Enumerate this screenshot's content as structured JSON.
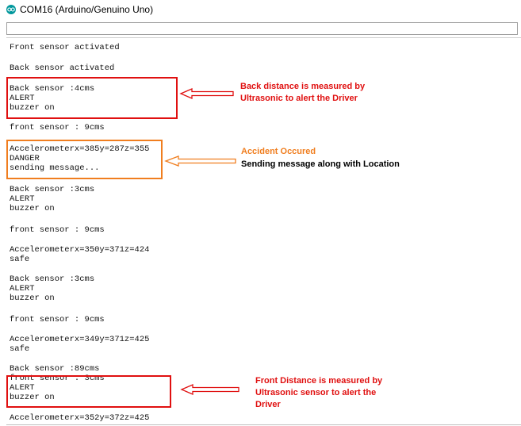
{
  "window": {
    "title": "COM16 (Arduino/Genuino Uno)",
    "app_icon": "arduino-logo-icon",
    "accent": "#00979c"
  },
  "send_input": {
    "value": "",
    "placeholder": ""
  },
  "serial_output": [
    "Front sensor activated",
    "Back sensor activated",
    "Back sensor :4cms",
    "ALERT",
    "buzzer on",
    "front sensor : 9cms",
    "Accelerometerx=385y=287z=355",
    "DANGER",
    "sending message...",
    "Back sensor :3cms",
    "ALERT",
    "buzzer on",
    "front sensor : 9cms",
    "Accelerometerx=350y=371z=424",
    "safe",
    "Back sensor :3cms",
    "ALERT",
    "buzzer on",
    "front sensor : 9cms",
    "Accelerometerx=349y=371z=425",
    "safe",
    "Back sensor :89cms",
    "front sensor : 3cms",
    "ALERT",
    "buzzer on",
    "Accelerometerx=352y=372z=425"
  ],
  "annotations": {
    "back": {
      "line1": "Back distance is measured by",
      "line2": "Ultrasonic to alert the Driver",
      "color": "#e01010"
    },
    "accident": {
      "line1": "Accident Occured",
      "line2": "Sending message along with Location",
      "color": "#f07e1f"
    },
    "front": {
      "line1": "Front Distance is measured by",
      "line2": "Ultrasonic sensor to alert the",
      "line3": "Driver",
      "color": "#e01010"
    }
  }
}
